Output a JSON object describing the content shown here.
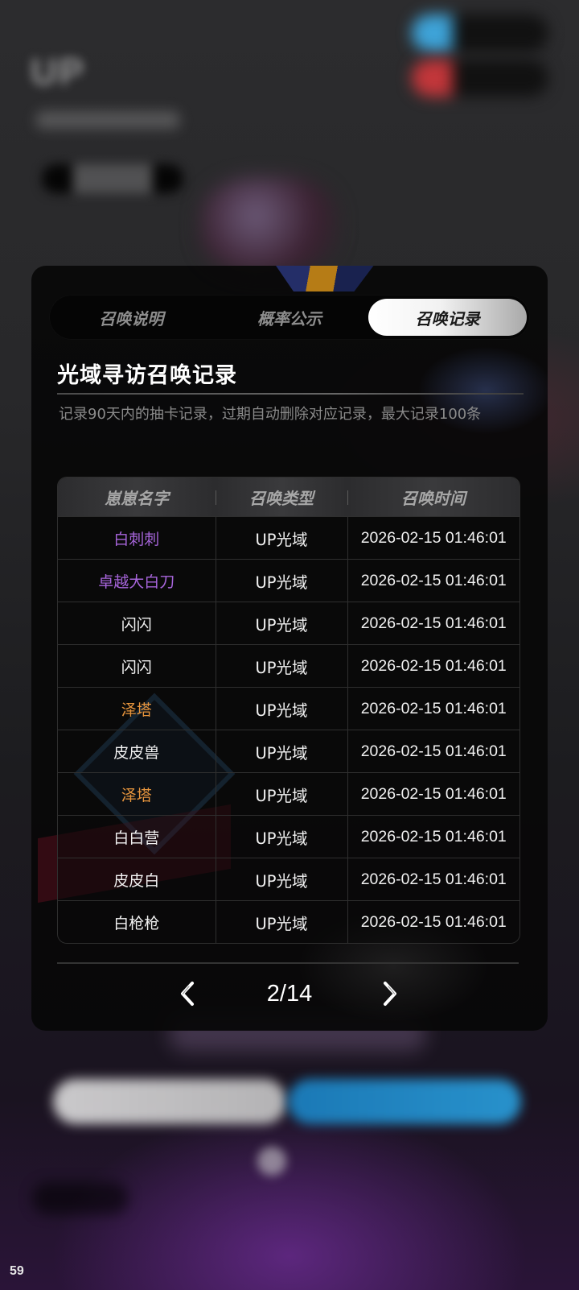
{
  "status": {
    "number": "59"
  },
  "tabs": [
    {
      "label": "召唤说明",
      "active": false
    },
    {
      "label": "概率公示",
      "active": false
    },
    {
      "label": "召唤记录",
      "active": true
    }
  ],
  "record": {
    "title": "光域寻访召唤记录",
    "description": "记录90天内的抽卡记录，过期自动删除对应记录，最大记录100条",
    "columns": [
      "崽崽名字",
      "召唤类型",
      "召唤时间"
    ],
    "rows": [
      {
        "name": "白刺刺",
        "type": "UP光域",
        "time": "2026-02-15 01:46:01",
        "color": "#a765db"
      },
      {
        "name": "卓越大白刀",
        "type": "UP光域",
        "time": "2026-02-15 01:46:01",
        "color": "#a765db"
      },
      {
        "name": "闪闪",
        "type": "UP光域",
        "time": "2026-02-15 01:46:01",
        "color": "#f2f2f2"
      },
      {
        "name": "闪闪",
        "type": "UP光域",
        "time": "2026-02-15 01:46:01",
        "color": "#f2f2f2"
      },
      {
        "name": "泽塔",
        "type": "UP光域",
        "time": "2026-02-15 01:46:01",
        "color": "#e7953d"
      },
      {
        "name": "皮皮兽",
        "type": "UP光域",
        "time": "2026-02-15 01:46:01",
        "color": "#f2f2f2"
      },
      {
        "name": "泽塔",
        "type": "UP光域",
        "time": "2026-02-15 01:46:01",
        "color": "#e7953d"
      },
      {
        "name": "白白营",
        "type": "UP光域",
        "time": "2026-02-15 01:46:01",
        "color": "#f2f2f2"
      },
      {
        "name": "皮皮白",
        "type": "UP光域",
        "time": "2026-02-15 01:46:01",
        "color": "#f2f2f2"
      },
      {
        "name": "白枪枪",
        "type": "UP光域",
        "time": "2026-02-15 01:46:01",
        "color": "#f2f2f2"
      }
    ]
  },
  "pagination": {
    "indicator": "2/14",
    "prev_icon": "chevron-left-icon",
    "next_icon": "chevron-right-icon"
  }
}
